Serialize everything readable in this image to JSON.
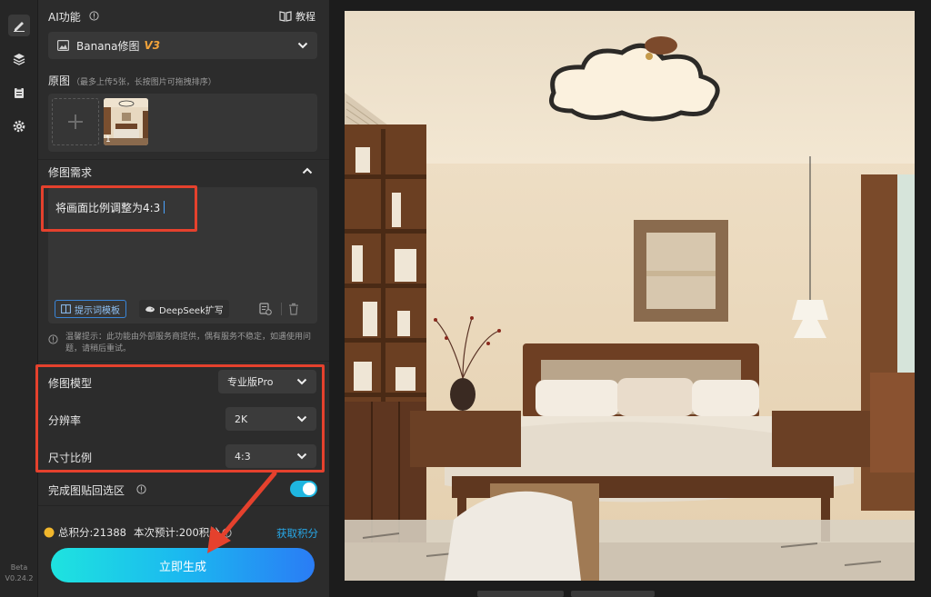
{
  "panel": {
    "ai_title": "AI功能",
    "tutorial_label": "教程",
    "model_name": "Banana修图",
    "model_version": "V3",
    "original_title": "原图",
    "original_hint": "（最多上传5张，长按图片可拖拽排序）",
    "thumb_index": "1",
    "requirement_title": "修图需求",
    "prompt_text": "将画面比例调整为4:3",
    "template_btn": "提示词模板",
    "deepseek_btn": "DeepSeek扩写",
    "warm_tip": "温馨提示：此功能由外部服务商提供，偶有服务不稳定，如遇使用问题，请稍后重试。",
    "model_label": "修图模型",
    "model_value": "专业版Pro",
    "resolution_label": "分辨率",
    "resolution_value": "2K",
    "ratio_label": "尺寸比例",
    "ratio_value": "4:3",
    "paste_back_label": "完成图贴回选区",
    "paste_back_on": true,
    "points_total": "总积分:21388",
    "points_estimate": "本次预计:200积分",
    "get_points": "获取积分",
    "generate_btn": "立即生成"
  },
  "rail": {
    "beta": "Beta",
    "version": "V0.24.2"
  },
  "colors": {
    "accent": "#1fb6e0",
    "highlight_red": "#e5412d",
    "version_orange": "#f2a33a",
    "link_blue": "#27a8e8"
  }
}
